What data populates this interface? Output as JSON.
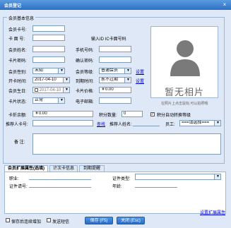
{
  "window": {
    "title": "会员登记",
    "close": "×"
  },
  "group_title": "会员基本信息",
  "labels": {
    "card_no": "会员卡号:",
    "sub_card": "卡 面 号:",
    "name": "会员姓名:",
    "password": "卡片密码:",
    "gender": "会员性别:",
    "open_date": "开卡时间:",
    "birthday": "会员生日:",
    "card_status": "卡片状态:",
    "phone": "手机号码:",
    "confirm_pwd": "确认密码:",
    "level": "会员等级:",
    "expire": "到期时间:",
    "card_value": "卡片价格:",
    "email": "电子邮箱:",
    "balance": "卡折余额:",
    "points": "积分数量:",
    "referrer_card": "推荐人卡号:",
    "referrer_name": "推荐人姓名:",
    "staff": "员工:",
    "remark": "备 注:",
    "id_hint": "输入ID IC卡面号码"
  },
  "values": {
    "gender": "未知",
    "open_date": "2017-04-10",
    "birthday": "2017-04-10",
    "card_status": "正常",
    "level": "普通会员",
    "expire": "永不过期",
    "card_value": "￥0.00",
    "balance": "￥0.00",
    "points": "0",
    "staff": "===请选择==="
  },
  "links": {
    "settings": "设置",
    "query": "查找",
    "expand_settings": "设置扩展属性"
  },
  "checkboxes": {
    "auto_upgrade": "积分自动转换等级",
    "save_print": "保存后连续增加",
    "send_sms": "发送短信"
  },
  "photo": {
    "placeholder": "暂无相片",
    "note": "在照片上点击鼠标,可以拍照哦"
  },
  "tabs": [
    "会员扩展属性(选填)",
    "计次卡信息",
    "到期提醒"
  ],
  "ext": {
    "job": "职业:",
    "id_type": "证件类型:",
    "id_no": "证件请号:",
    "age": "年龄:"
  },
  "buttons": {
    "save": "保存 (F5)",
    "close": "关闭 (Esc)"
  }
}
